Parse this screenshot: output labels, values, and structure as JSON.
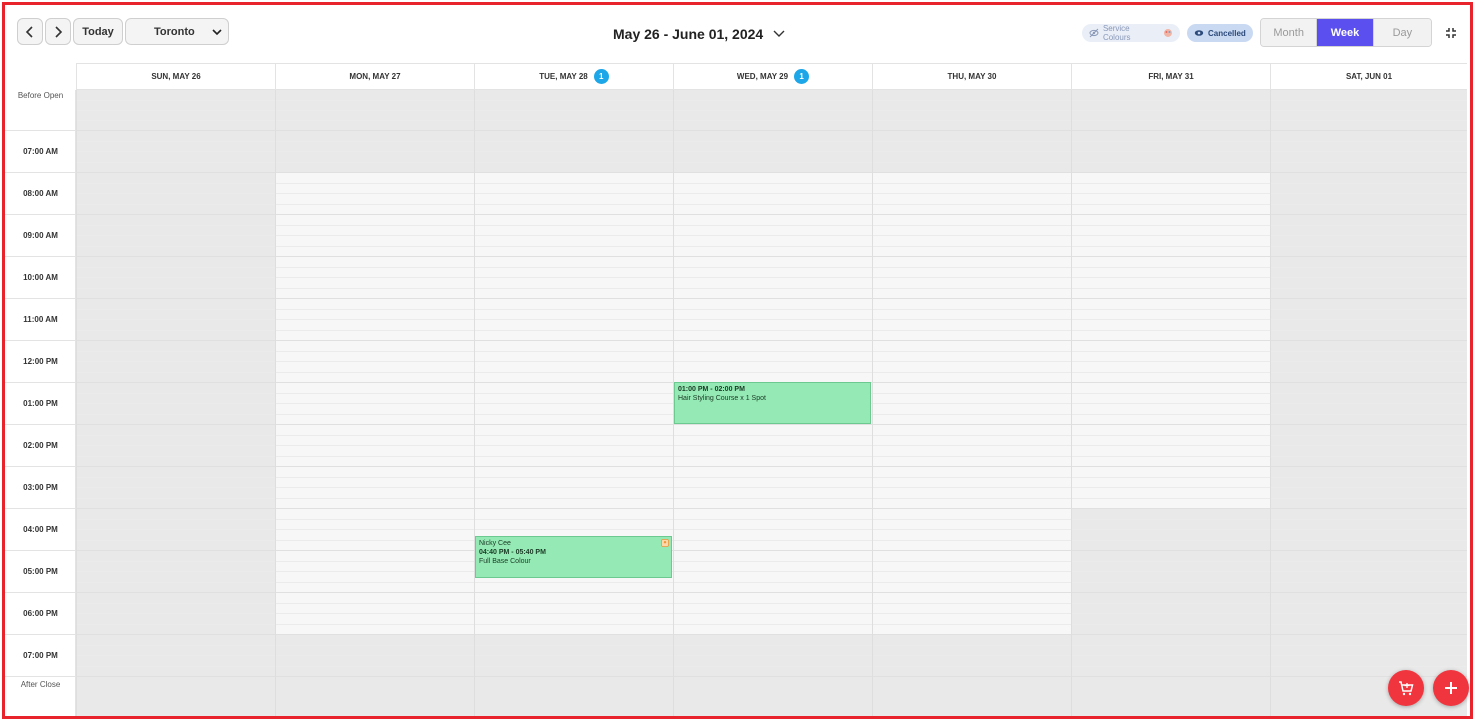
{
  "toolbar": {
    "today_label": "Today",
    "location": "Toronto",
    "date_range": "May 26 - June 01, 2024",
    "service_colours_label": "Service Colours",
    "cancelled_label": "Cancelled",
    "views": [
      "Month",
      "Week",
      "Day"
    ],
    "active_view": "Week"
  },
  "days": [
    {
      "label": "SUN, MAY 26",
      "badge": ""
    },
    {
      "label": "MON, MAY 27",
      "badge": ""
    },
    {
      "label": "TUE, MAY 28",
      "badge": "1"
    },
    {
      "label": "WED, MAY 29",
      "badge": "1"
    },
    {
      "label": "THU, MAY 30",
      "badge": ""
    },
    {
      "label": "FRI, MAY 31",
      "badge": ""
    },
    {
      "label": "SAT, JUN 01",
      "badge": ""
    }
  ],
  "time_labels": {
    "before_open": "Before Open",
    "after_close": "After Close",
    "hours": [
      "07:00 AM",
      "08:00 AM",
      "09:00 AM",
      "10:00 AM",
      "11:00 AM",
      "12:00 PM",
      "01:00 PM",
      "02:00 PM",
      "03:00 PM",
      "04:00 PM",
      "05:00 PM",
      "06:00 PM",
      "07:00 PM"
    ]
  },
  "events": [
    {
      "day": 3,
      "time": "01:00 PM - 02:00 PM",
      "title": "Hair Styling Course x 1 Spot",
      "client": ""
    },
    {
      "day": 2,
      "time": "04:40 PM - 05:40 PM",
      "title": "Full Base Colour",
      "client": "Nicky Cee"
    }
  ],
  "colors": {
    "accent": "#5b4ff0",
    "event_green": "#95e9b4",
    "badge_blue": "#1ea7e8",
    "fab_red": "#f0353f"
  }
}
